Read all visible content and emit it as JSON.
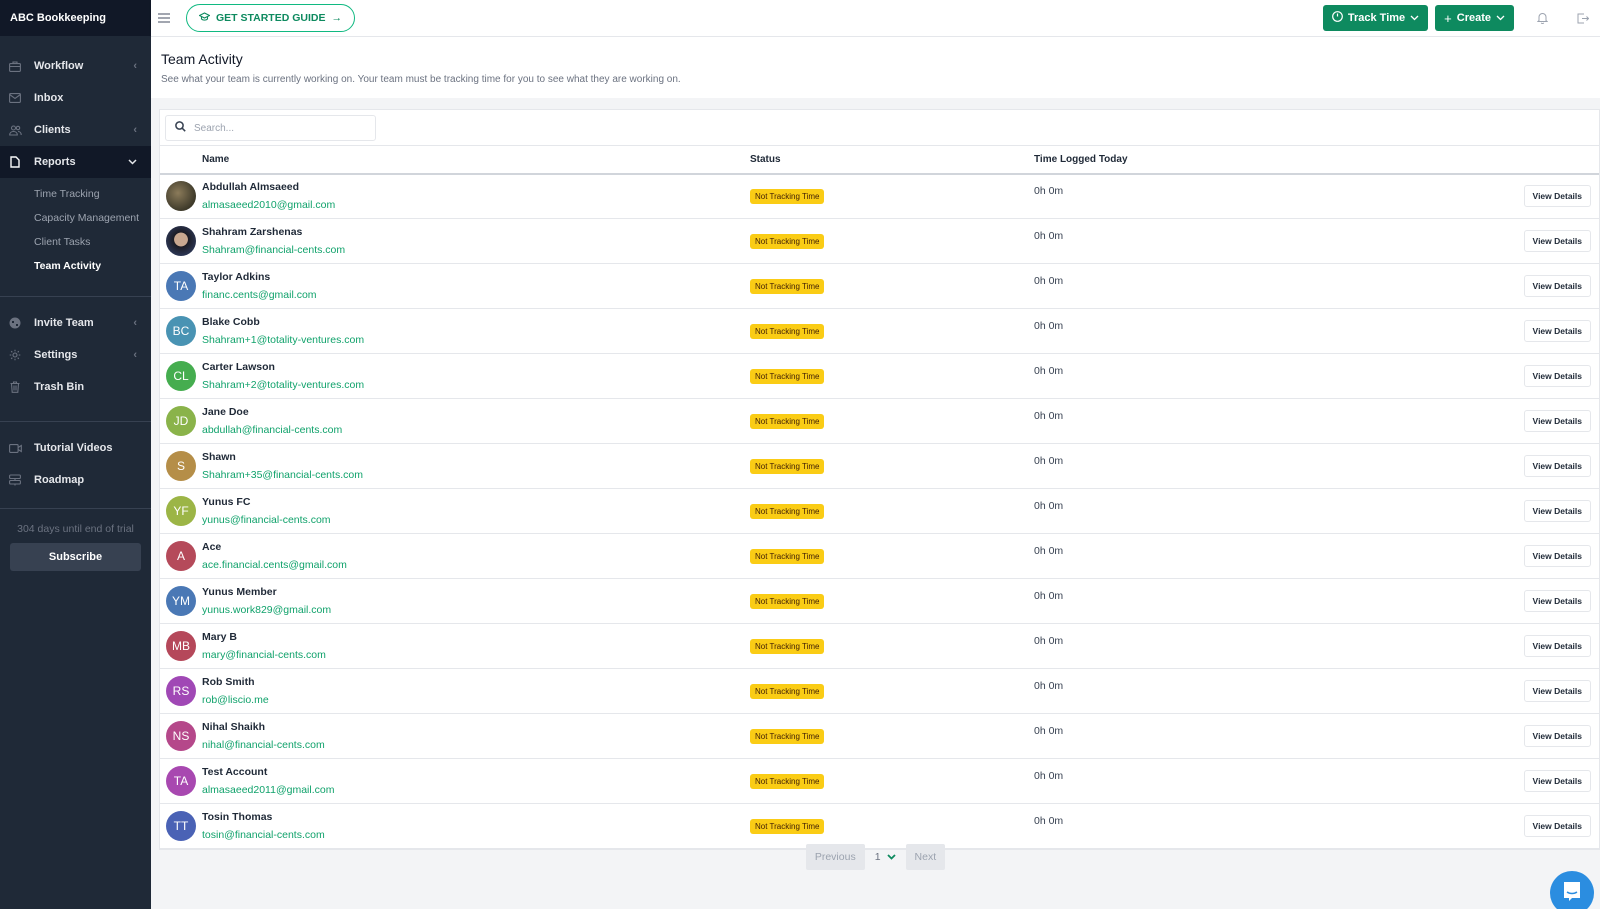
{
  "app": {
    "brand": "ABC Bookkeeping"
  },
  "sidebar": {
    "items": [
      {
        "label": "Workflow",
        "icon": "briefcase-icon",
        "chevron": "‹"
      },
      {
        "label": "Inbox",
        "icon": "mail-icon",
        "chevron": ""
      },
      {
        "label": "Clients",
        "icon": "users-icon",
        "chevron": "‹"
      },
      {
        "label": "Reports",
        "icon": "file-icon",
        "chevron": "⌄"
      }
    ],
    "report_subitems": [
      {
        "label": "Time Tracking"
      },
      {
        "label": "Capacity Management"
      },
      {
        "label": "Client Tasks"
      },
      {
        "label": "Team Activity"
      }
    ],
    "items2": [
      {
        "label": "Invite Team",
        "chevron": "‹"
      },
      {
        "label": "Settings",
        "chevron": "‹"
      },
      {
        "label": "Trash Bin",
        "chevron": ""
      }
    ],
    "items3": [
      {
        "label": "Tutorial Videos"
      },
      {
        "label": "Roadmap"
      }
    ],
    "trial_text": "304 days until end of trial",
    "subscribe_label": "Subscribe"
  },
  "topbar": {
    "guide_label": "GET STARTED GUIDE",
    "track_time_label": "Track Time",
    "create_label": "Create"
  },
  "page": {
    "title": "Team Activity",
    "subtitle": "See what your team is currently working on. Your team must be tracking time for you to see what they are working on."
  },
  "search": {
    "placeholder": "Search...",
    "value": ""
  },
  "table": {
    "headers": {
      "name": "Name",
      "status": "Status",
      "time": "Time Logged Today"
    },
    "view_label": "View Details",
    "rows": [
      {
        "initials": "",
        "avatar": "photo1",
        "color": "",
        "name": "Abdullah Almsaeed",
        "email": "almasaeed2010@gmail.com",
        "status": "Not Tracking Time",
        "time": "0h 0m"
      },
      {
        "initials": "",
        "avatar": "photo2",
        "color": "",
        "name": "Shahram Zarshenas",
        "email": "Shahram@financial-cents.com",
        "status": "Not Tracking Time",
        "time": "0h 0m"
      },
      {
        "initials": "TA",
        "avatar": "",
        "color": "#4a78b5",
        "name": "Taylor Adkins",
        "email": "financ.cents@gmail.com",
        "status": "Not Tracking Time",
        "time": "0h 0m"
      },
      {
        "initials": "BC",
        "avatar": "",
        "color": "#4993b3",
        "name": "Blake Cobb",
        "email": "Shahram+1@totality-ventures.com",
        "status": "Not Tracking Time",
        "time": "0h 0m"
      },
      {
        "initials": "CL",
        "avatar": "",
        "color": "#45ad4f",
        "name": "Carter Lawson",
        "email": "Shahram+2@totality-ventures.com",
        "status": "Not Tracking Time",
        "time": "0h 0m"
      },
      {
        "initials": "JD",
        "avatar": "",
        "color": "#8ab34a",
        "name": "Jane Doe",
        "email": "abdullah@financial-cents.com",
        "status": "Not Tracking Time",
        "time": "0h 0m"
      },
      {
        "initials": "S",
        "avatar": "",
        "color": "#b58e48",
        "name": "Shawn",
        "email": "Shahram+35@financial-cents.com",
        "status": "Not Tracking Time",
        "time": "0h 0m"
      },
      {
        "initials": "YF",
        "avatar": "",
        "color": "#9cb546",
        "name": "Yunus FC",
        "email": "yunus@financial-cents.com",
        "status": "Not Tracking Time",
        "time": "0h 0m"
      },
      {
        "initials": "A",
        "avatar": "",
        "color": "#b54a5a",
        "name": "Ace",
        "email": "ace.financial.cents@gmail.com",
        "status": "Not Tracking Time",
        "time": "0h 0m"
      },
      {
        "initials": "YM",
        "avatar": "",
        "color": "#4a78b5",
        "name": "Yunus Member",
        "email": "yunus.work829@gmail.com",
        "status": "Not Tracking Time",
        "time": "0h 0m"
      },
      {
        "initials": "MB",
        "avatar": "",
        "color": "#b5485a",
        "name": "Mary B",
        "email": "mary@financial-cents.com",
        "status": "Not Tracking Time",
        "time": "0h 0m"
      },
      {
        "initials": "RS",
        "avatar": "",
        "color": "#a048b5",
        "name": "Rob Smith",
        "email": "rob@liscio.me",
        "status": "Not Tracking Time",
        "time": "0h 0m"
      },
      {
        "initials": "NS",
        "avatar": "",
        "color": "#b5488a",
        "name": "Nihal Shaikh",
        "email": "nihal@financial-cents.com",
        "status": "Not Tracking Time",
        "time": "0h 0m"
      },
      {
        "initials": "TA",
        "avatar": "",
        "color": "#a848b0",
        "name": "Test Account",
        "email": "almasaeed2011@gmail.com",
        "status": "Not Tracking Time",
        "time": "0h 0m"
      },
      {
        "initials": "TT",
        "avatar": "",
        "color": "#4a62b5",
        "name": "Tosin Thomas",
        "email": "tosin@financial-cents.com",
        "status": "Not Tracking Time",
        "time": "0h 0m"
      }
    ]
  },
  "pagination": {
    "previous_label": "Previous",
    "current_page": "1",
    "next_label": "Next"
  },
  "colors": {
    "brand_green": "#0e8a5f",
    "badge_yellow": "#facc15",
    "sidebar_bg": "#1f2937",
    "email_green": "#10a26b",
    "chat_blue": "#2b8de0"
  }
}
